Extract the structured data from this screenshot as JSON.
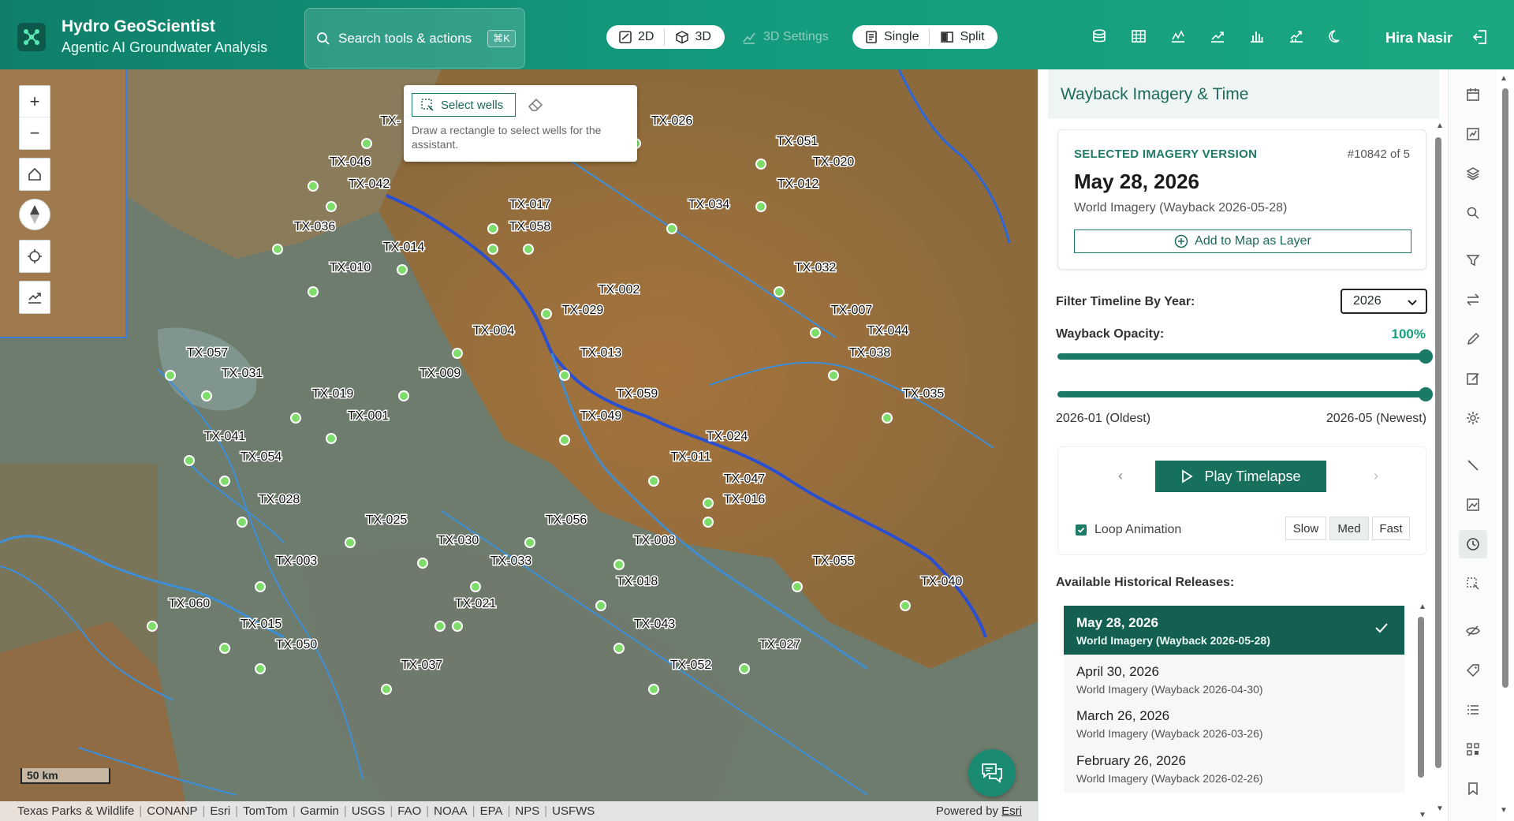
{
  "header": {
    "title": "Hydro GeoScientist",
    "subtitle": "Agentic AI Groundwater Analysis",
    "search_placeholder": "Search tools & actions",
    "search_shortcut": "⌘K",
    "view_2d": "2D",
    "view_3d": "3D",
    "settings_3d": "3D Settings",
    "mode_single": "Single",
    "mode_split": "Split",
    "user_name": "Hira Nasir",
    "icons": [
      "database-icon",
      "table-icon",
      "line-chart-icon",
      "trend-icon",
      "bar-chart-icon",
      "analysis-icon",
      "moon-icon",
      "logout-icon"
    ]
  },
  "map": {
    "select_wells_label": "Select wells",
    "select_hint": "Draw a rectangle to select wells for the assistant.",
    "scale_label": "50 km",
    "attribution": [
      "Texas Parks & Wildlife",
      "CONANP",
      "Esri",
      "TomTom",
      "Garmin",
      "USGS",
      "FAO",
      "NOAA",
      "EPA",
      "NPS",
      "USFWS"
    ],
    "powered_prefix": "Powered by",
    "powered_link": "Esri",
    "wells": [
      {
        "id": "TX-026"
      },
      {
        "id": "TX-051"
      },
      {
        "id": "TX-020"
      },
      {
        "id": "TX-046"
      },
      {
        "id": "TX-042"
      },
      {
        "id": "TX-012"
      },
      {
        "id": "TX-017"
      },
      {
        "id": "TX-034"
      },
      {
        "id": "TX-058"
      },
      {
        "id": "TX-036"
      },
      {
        "id": "TX-014"
      },
      {
        "id": "TX-010"
      },
      {
        "id": "TX-032"
      },
      {
        "id": "TX-002"
      },
      {
        "id": "TX-029"
      },
      {
        "id": "TX-007"
      },
      {
        "id": "TX-004"
      },
      {
        "id": "TX-044"
      },
      {
        "id": "TX-013"
      },
      {
        "id": "TX-038"
      },
      {
        "id": "TX-057"
      },
      {
        "id": "TX-031"
      },
      {
        "id": "TX-009"
      },
      {
        "id": "TX-035"
      },
      {
        "id": "TX-019"
      },
      {
        "id": "TX-059"
      },
      {
        "id": "TX-001"
      },
      {
        "id": "TX-049"
      },
      {
        "id": "TX-041"
      },
      {
        "id": "TX-024"
      },
      {
        "id": "TX-054"
      },
      {
        "id": "TX-011"
      },
      {
        "id": "TX-047"
      },
      {
        "id": "TX-028"
      },
      {
        "id": "TX-016"
      },
      {
        "id": "TX-025"
      },
      {
        "id": "TX-056"
      },
      {
        "id": "TX-030"
      },
      {
        "id": "TX-008"
      },
      {
        "id": "TX-003"
      },
      {
        "id": "TX-033"
      },
      {
        "id": "TX-055"
      },
      {
        "id": "TX-018"
      },
      {
        "id": "TX-040"
      },
      {
        "id": "TX-060"
      },
      {
        "id": "TX-021"
      },
      {
        "id": "TX-015"
      },
      {
        "id": "TX-043"
      },
      {
        "id": "TX-050"
      },
      {
        "id": "TX-027"
      },
      {
        "id": "TX-037"
      },
      {
        "id": "TX-052"
      },
      {
        "id": "TX-"
      }
    ]
  },
  "panel": {
    "title": "Wayback Imagery & Time",
    "selected_label": "SELECTED IMAGERY VERSION",
    "selected_index": "#10842 of 5",
    "selected_date": "May 28, 2026",
    "selected_layer": "World Imagery (Wayback 2026-05-28)",
    "add_button": "Add to Map as Layer",
    "filter_label": "Filter Timeline By Year:",
    "year": "2026",
    "opacity_label": "Wayback Opacity:",
    "opacity": "100%",
    "opacity_fraction": 1.0,
    "range_min": "2026-01 (Oldest)",
    "range_max": "2026-05 (Newest)",
    "play_label": "Play Timelapse",
    "loop_label": "Loop Animation",
    "speeds": [
      "Slow",
      "Med",
      "Fast"
    ],
    "active_speed": "Med",
    "releases_label": "Available Historical Releases:",
    "releases": [
      {
        "date": "May 28, 2026",
        "layer": "World Imagery (Wayback 2026-05-28)",
        "selected": true
      },
      {
        "date": "April 30, 2026",
        "layer": "World Imagery (Wayback 2026-04-30)",
        "selected": false
      },
      {
        "date": "March 26, 2026",
        "layer": "World Imagery (Wayback 2026-03-26)",
        "selected": false
      },
      {
        "date": "February 26, 2026",
        "layer": "World Imagery (Wayback 2026-02-26)",
        "selected": false
      }
    ]
  },
  "rail_icons": [
    "calendar-icon",
    "chart-box-icon",
    "layers-icon",
    "search-icon",
    "filter-icon",
    "swap-icon",
    "pencil-icon",
    "edit-icon",
    "gear-icon",
    "wand-icon",
    "image-box-icon",
    "clock-icon",
    "select-area-icon",
    "eye-off-icon",
    "tag-icon",
    "list-icon",
    "qr-icon",
    "bookmark-icon"
  ],
  "colors": {
    "brand": "#14997c",
    "accent": "#17705e",
    "well_fill": "#7ddc6a"
  }
}
